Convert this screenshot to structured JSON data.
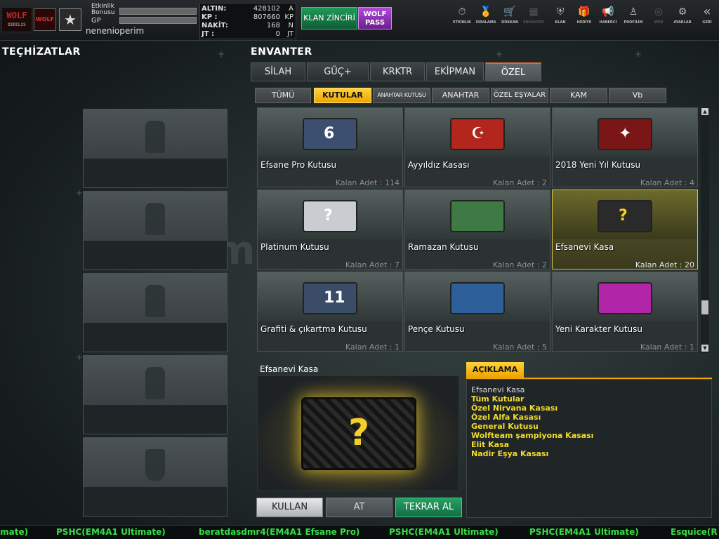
{
  "header": {
    "logo_text": "WOLF",
    "logo_sub": "DIRILIS",
    "rank_badge": "WOLF",
    "star_glyph": "★",
    "event_bonus_label": "Etkinlik\nBonusu",
    "gp_label": "GP",
    "username": "nenenioperim",
    "currency": [
      {
        "key": "ALTIN:",
        "value": "428102",
        "unit": "A"
      },
      {
        "key": "KP :",
        "value": "807660",
        "unit": "KP"
      },
      {
        "key": "NAKİT:",
        "value": "168",
        "unit": "N"
      },
      {
        "key": "JT :",
        "value": "0",
        "unit": "JT"
      }
    ],
    "klan_button": "KLAN ZİNCİRİ",
    "wolf_pass_button": "WOLF\nPASS",
    "menu": [
      {
        "label": "ETKİNLİK",
        "icon": "⏱"
      },
      {
        "label": "SIRALAMA",
        "icon": "🏅"
      },
      {
        "label": "DÜKKAN",
        "icon": "🛒"
      },
      {
        "label": "ENVANTER",
        "icon": "▦"
      },
      {
        "label": "KLAN",
        "icon": "⛨"
      },
      {
        "label": "HEDİYE",
        "icon": "🎁"
      },
      {
        "label": "HABERCİ",
        "icon": "📢"
      },
      {
        "label": "PROFİLİM",
        "icon": "♙"
      },
      {
        "label": "WEB",
        "icon": "◎"
      },
      {
        "label": "AYARLAR",
        "icon": "⚙"
      },
      {
        "label": "GERİ",
        "icon": "«"
      }
    ]
  },
  "equipment": {
    "title": "TEÇHİZATLAR"
  },
  "inventory": {
    "title": "ENVANTER",
    "tabs": [
      "SİLAH",
      "GÜÇ+",
      "KRKTR",
      "EKİPMAN",
      "ÖZEL"
    ],
    "subtabs": [
      "TÜMÜ",
      "KUTULAR",
      "ANAHTAR KUTUSU",
      "ANAHTAR",
      "ÖZEL EŞYALAR",
      "KAM",
      "Vb"
    ],
    "items": [
      {
        "name": "Efsane Pro Kutusu",
        "count": "Kalan Adet : 114",
        "box_color": "#3c4f6e",
        "glyph": "6"
      },
      {
        "name": "Ayyıldız Kasası",
        "count": "Kalan Adet : 2",
        "box_color": "#b3261e",
        "glyph": "☪"
      },
      {
        "name": "2018 Yeni Yıl Kutusu",
        "count": "Kalan Adet : 4",
        "box_color": "#7a1616",
        "glyph": "✦"
      },
      {
        "name": "Platinum Kutusu",
        "count": "Kalan Adet : 7",
        "box_color": "#c9ccd0",
        "glyph": "?"
      },
      {
        "name": "Ramazan Kutusu",
        "count": "Kalan Adet : 2",
        "box_color": "#3f7a44",
        "glyph": ""
      },
      {
        "name": "Efsanevi Kasa",
        "count": "Kalan Adet : 20",
        "box_color": "#2a2a2a",
        "glyph": "?"
      },
      {
        "name": "Grafiti & çıkartma Kutusu",
        "count": "Kalan Adet : 1",
        "box_color": "#3a4c68",
        "glyph": "11"
      },
      {
        "name": "Pençe Kutusu",
        "count": "Kalan Adet : 5",
        "box_color": "#2d5f99",
        "glyph": ""
      },
      {
        "name": "Yeni Karakter Kutusu",
        "count": "Kalan Adet : 1",
        "box_color": "#b126a8",
        "glyph": ""
      }
    ]
  },
  "detail": {
    "title": "Efsanevi Kasa",
    "big_glyph": "?",
    "buttons": {
      "use": "KULLAN",
      "drop": "AT",
      "rebuy": "TEKRAR AL"
    }
  },
  "description": {
    "tab": "AÇIKLAMA",
    "item_name": "Efsanevi Kasa",
    "contents": [
      "Tüm Kutular",
      "Özel Nirvana Kasası",
      "Özel Alfa Kasası",
      "General Kutusu",
      "Wolfteam şampiyona Kasası",
      "Elit Kasa",
      "Nadir Eşya Kasası"
    ]
  },
  "ticker": [
    "imate)",
    "PSHC(EM4A1 Ultimate)",
    "beratdasdmr4(EM4A1 Efsane Pro)",
    "PSHC(EM4A1 Ultimate)",
    "PSHC(EM4A1 Ultimate)",
    "Esquice(R"
  ],
  "watermark": "itemsatis",
  "colors": {
    "accent_yellow": "#eda400",
    "tab_active_border": "#e26c31",
    "ticker_green": "#35e040",
    "selected_border": "#d8c23e"
  }
}
